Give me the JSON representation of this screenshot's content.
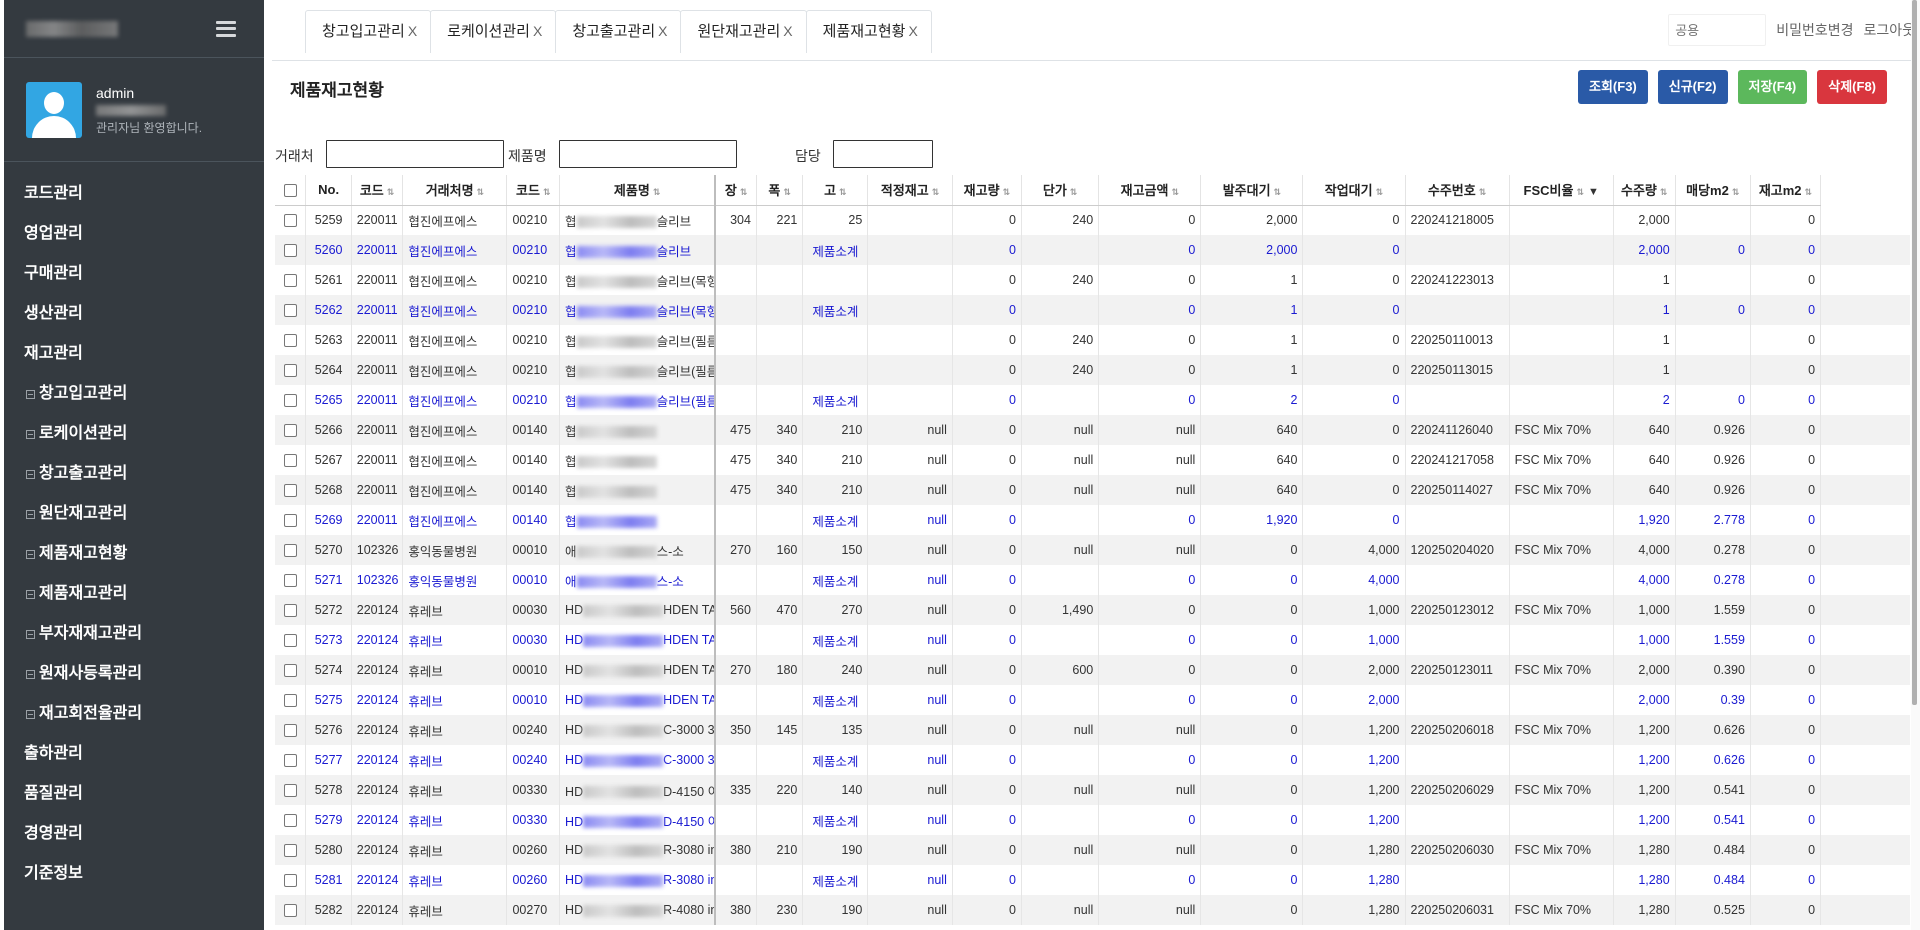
{
  "sidebar": {
    "user": {
      "name": "admin",
      "welcome": "관리자님 환영합니다."
    },
    "menu": [
      {
        "label": "코드관리",
        "sub": false
      },
      {
        "label": "영업관리",
        "sub": false
      },
      {
        "label": "구매관리",
        "sub": false
      },
      {
        "label": "생산관리",
        "sub": false
      },
      {
        "label": "재고관리",
        "sub": false
      },
      {
        "label": "창고입고관리",
        "sub": true
      },
      {
        "label": "로케이션관리",
        "sub": true
      },
      {
        "label": "창고출고관리",
        "sub": true
      },
      {
        "label": "원단재고관리",
        "sub": true
      },
      {
        "label": "제품재고현황",
        "sub": true
      },
      {
        "label": "제품재고관리",
        "sub": true
      },
      {
        "label": "부자재재고관리",
        "sub": true
      },
      {
        "label": "원재사등록관리",
        "sub": true
      },
      {
        "label": "재고회전율관리",
        "sub": true
      },
      {
        "label": "출하관리",
        "sub": false
      },
      {
        "label": "품질관리",
        "sub": false
      },
      {
        "label": "경영관리",
        "sub": false
      },
      {
        "label": "기준정보",
        "sub": false
      }
    ]
  },
  "tabs": [
    {
      "label": "창고입고관리",
      "close": "X"
    },
    {
      "label": "로케이션관리",
      "close": "X"
    },
    {
      "label": "창고출고관리",
      "close": "X"
    },
    {
      "label": "원단재고관리",
      "close": "X"
    },
    {
      "label": "제품재고현황",
      "close": "X"
    }
  ],
  "topbar": {
    "share_placeholder": "공용",
    "change_password": "비밀번호변경",
    "logout": "로그아웃"
  },
  "page": {
    "title": "제품재고현황"
  },
  "actions": {
    "search": "조회(F3)",
    "new": "신규(F2)",
    "save": "저장(F4)",
    "delete": "삭제(F8)"
  },
  "filters": {
    "client": "거래처",
    "product": "제품명",
    "manager": "담당"
  },
  "table": {
    "columns": [
      "No.",
      "코드",
      "거래처명",
      "코드",
      "제품명",
      "장",
      "폭",
      "고",
      "적정재고",
      "재고량",
      "단가",
      "재고금액",
      "발주대기",
      "작업대기",
      "수주번호",
      "FSC비율",
      "수주량",
      "매당m2",
      "재고m2"
    ],
    "rows": [
      {
        "sub": false,
        "cells": [
          "5259",
          "220011",
          "협진에프에스",
          "00210",
          "협",
          "슬리브",
          "304",
          "221",
          "25",
          "",
          "0",
          "240",
          "0",
          "2,000",
          "0",
          "220241218005",
          "",
          "2,000",
          "",
          "0"
        ]
      },
      {
        "sub": true,
        "cells": [
          "5260",
          "220011",
          "협진에프에스",
          "00210",
          "협",
          "슬리브",
          "",
          "",
          "제품소계",
          "",
          "0",
          "",
          "0",
          "2,000",
          "0",
          "",
          "",
          "2,000",
          "0",
          "0"
        ]
      },
      {
        "sub": false,
        "cells": [
          "5261",
          "220011",
          "협진에프에스",
          "00210",
          "협",
          "슬리브(목형",
          "",
          "",
          "",
          "",
          "0",
          "240",
          "0",
          "1",
          "0",
          "220241223013",
          "",
          "1",
          "",
          "0"
        ]
      },
      {
        "sub": true,
        "cells": [
          "5262",
          "220011",
          "협진에프에스",
          "00210",
          "협",
          "슬리브(목형",
          "",
          "",
          "제품소계",
          "",
          "0",
          "",
          "0",
          "1",
          "0",
          "",
          "",
          "1",
          "0",
          "0"
        ]
      },
      {
        "sub": false,
        "cells": [
          "5263",
          "220011",
          "협진에프에스",
          "00210",
          "협",
          "슬리브(필름",
          "",
          "",
          "",
          "",
          "0",
          "240",
          "0",
          "1",
          "0",
          "220250110013",
          "",
          "1",
          "",
          "0"
        ]
      },
      {
        "sub": false,
        "cells": [
          "5264",
          "220011",
          "협진에프에스",
          "00210",
          "협",
          "슬리브(필름",
          "",
          "",
          "",
          "",
          "0",
          "240",
          "0",
          "1",
          "0",
          "220250113015",
          "",
          "1",
          "",
          "0"
        ]
      },
      {
        "sub": true,
        "cells": [
          "5265",
          "220011",
          "협진에프에스",
          "00210",
          "협",
          "슬리브(필름",
          "",
          "",
          "제품소계",
          "",
          "0",
          "",
          "0",
          "2",
          "0",
          "",
          "",
          "2",
          "0",
          "0"
        ]
      },
      {
        "sub": false,
        "cells": [
          "5266",
          "220011",
          "협진에프에스",
          "00140",
          "협",
          "",
          "475",
          "340",
          "210",
          "null",
          "0",
          "null",
          "null",
          "640",
          "0",
          "220241126040",
          "FSC Mix 70%",
          "640",
          "0.926",
          "0"
        ]
      },
      {
        "sub": false,
        "cells": [
          "5267",
          "220011",
          "협진에프에스",
          "00140",
          "협",
          "",
          "475",
          "340",
          "210",
          "null",
          "0",
          "null",
          "null",
          "640",
          "0",
          "220241217058",
          "FSC Mix 70%",
          "640",
          "0.926",
          "0"
        ]
      },
      {
        "sub": false,
        "cells": [
          "5268",
          "220011",
          "협진에프에스",
          "00140",
          "협",
          "",
          "475",
          "340",
          "210",
          "null",
          "0",
          "null",
          "null",
          "640",
          "0",
          "220250114027",
          "FSC Mix 70%",
          "640",
          "0.926",
          "0"
        ]
      },
      {
        "sub": true,
        "cells": [
          "5269",
          "220011",
          "협진에프에스",
          "00140",
          "협",
          "",
          "",
          "",
          "제품소계",
          "null",
          "0",
          "",
          "0",
          "1,920",
          "0",
          "",
          "",
          "1,920",
          "2.778",
          "0"
        ]
      },
      {
        "sub": false,
        "cells": [
          "5270",
          "102326",
          "홍익동물병원",
          "00010",
          "애",
          "스-소",
          "270",
          "160",
          "150",
          "null",
          "0",
          "null",
          "null",
          "0",
          "4,000",
          "120250204020",
          "FSC Mix 70%",
          "4,000",
          "0.278",
          "0"
        ]
      },
      {
        "sub": true,
        "cells": [
          "5271",
          "102326",
          "홍익동물병원",
          "00010",
          "애",
          "스-소",
          "",
          "",
          "제품소계",
          "null",
          "0",
          "",
          "0",
          "0",
          "4,000",
          "",
          "",
          "4,000",
          "0.278",
          "0"
        ]
      },
      {
        "sub": false,
        "cells": [
          "5272",
          "220124",
          "휴레브",
          "00030",
          "HD",
          "HDEN TA",
          "560",
          "470",
          "270",
          "null",
          "0",
          "1,490",
          "0",
          "0",
          "1,000",
          "220250123012",
          "FSC Mix 70%",
          "1,000",
          "1.559",
          "0"
        ]
      },
      {
        "sub": true,
        "cells": [
          "5273",
          "220124",
          "휴레브",
          "00030",
          "HD",
          "HDEN TA",
          "",
          "",
          "제품소계",
          "null",
          "0",
          "",
          "0",
          "0",
          "1,000",
          "",
          "",
          "1,000",
          "1.559",
          "0"
        ]
      },
      {
        "sub": false,
        "cells": [
          "5274",
          "220124",
          "휴레브",
          "00010",
          "HD",
          "HDEN TA",
          "270",
          "180",
          "240",
          "null",
          "0",
          "600",
          "0",
          "0",
          "2,000",
          "220250123011",
          "FSC Mix 70%",
          "2,000",
          "0.390",
          "0"
        ]
      },
      {
        "sub": true,
        "cells": [
          "5275",
          "220124",
          "휴레브",
          "00010",
          "HD",
          "HDEN TA",
          "",
          "",
          "제품소계",
          "null",
          "0",
          "",
          "0",
          "0",
          "2,000",
          "",
          "",
          "2,000",
          "0.39",
          "0"
        ]
      },
      {
        "sub": false,
        "cells": [
          "5276",
          "220124",
          "휴레브",
          "00240",
          "HD",
          "C-3000 3",
          "350",
          "145",
          "135",
          "null",
          "0",
          "null",
          "null",
          "0",
          "1,200",
          "220250206018",
          "FSC Mix 70%",
          "1,200",
          "0.626",
          "0"
        ]
      },
      {
        "sub": true,
        "cells": [
          "5277",
          "220124",
          "휴레브",
          "00240",
          "HD",
          "C-3000 3",
          "",
          "",
          "제품소계",
          "null",
          "0",
          "",
          "0",
          "0",
          "1,200",
          "",
          "",
          "1,200",
          "0.626",
          "0"
        ]
      },
      {
        "sub": false,
        "cells": [
          "5278",
          "220124",
          "휴레브",
          "00330",
          "HD",
          "D-4150 이",
          "335",
          "220",
          "140",
          "null",
          "0",
          "null",
          "null",
          "0",
          "1,200",
          "220250206029",
          "FSC Mix 70%",
          "1,200",
          "0.541",
          "0"
        ]
      },
      {
        "sub": true,
        "cells": [
          "5279",
          "220124",
          "휴레브",
          "00330",
          "HD",
          "D-4150 이",
          "",
          "",
          "제품소계",
          "null",
          "0",
          "",
          "0",
          "0",
          "1,200",
          "",
          "",
          "1,200",
          "0.541",
          "0"
        ]
      },
      {
        "sub": false,
        "cells": [
          "5280",
          "220124",
          "휴레브",
          "00260",
          "HD",
          "R-3080 in",
          "380",
          "210",
          "190",
          "null",
          "0",
          "null",
          "null",
          "0",
          "1,280",
          "220250206030",
          "FSC Mix 70%",
          "1,280",
          "0.484",
          "0"
        ]
      },
      {
        "sub": true,
        "cells": [
          "5281",
          "220124",
          "휴레브",
          "00260",
          "HD",
          "R-3080 in",
          "",
          "",
          "제품소계",
          "null",
          "0",
          "",
          "0",
          "0",
          "1,280",
          "",
          "",
          "1,280",
          "0.484",
          "0"
        ]
      },
      {
        "sub": false,
        "cells": [
          "5282",
          "220124",
          "휴레브",
          "00270",
          "HD",
          "R-4080 in",
          "380",
          "230",
          "190",
          "null",
          "0",
          "null",
          "null",
          "0",
          "1,280",
          "220250206031",
          "FSC Mix 70%",
          "1,280",
          "0.525",
          "0"
        ]
      }
    ]
  },
  "colors": {
    "sidebar_bg": "#343a40",
    "btn_blue": "#2a5aa7",
    "btn_green": "#5cb85c",
    "btn_red": "#d9363e",
    "subtotal_text": "#1a1ad1"
  }
}
